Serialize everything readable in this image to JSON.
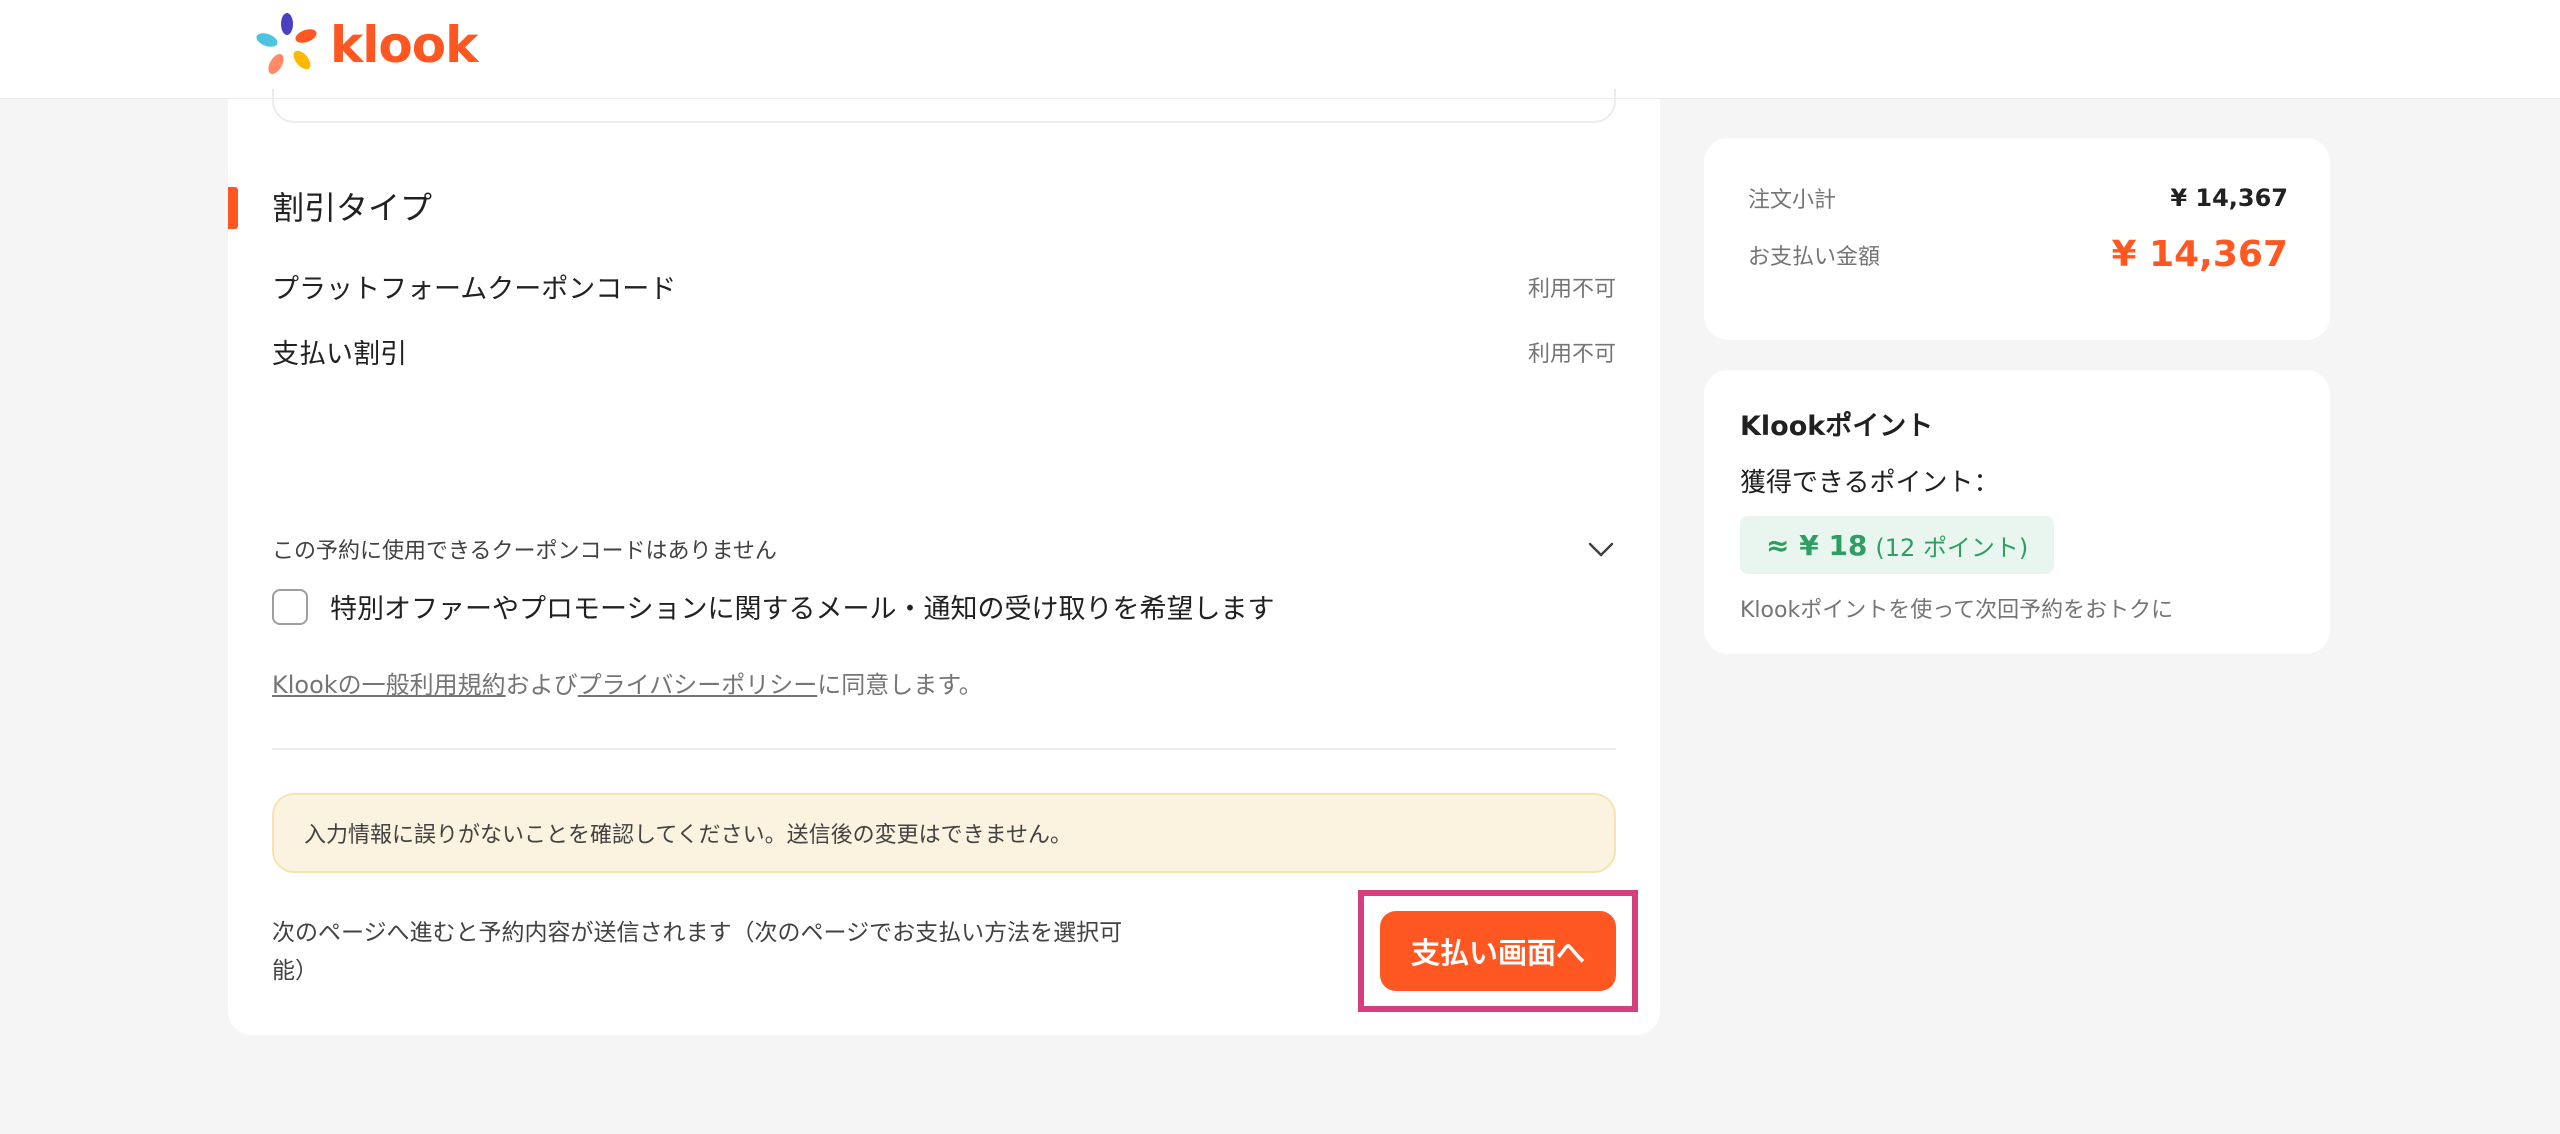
{
  "header": {
    "logo_text": "klook"
  },
  "discount": {
    "title": "割引タイプ",
    "rows": [
      {
        "label": "プラットフォームクーポンコード",
        "value": "利用不可"
      },
      {
        "label": "支払い割引",
        "value": "利用不可"
      }
    ],
    "coupon_text": "この予約に使用できるクーポンコードはありません"
  },
  "promo_checkbox_label": "特別オファーやプロモーションに関するメール・通知の受け取りを希望します",
  "terms": {
    "link1": "Klookの一般利用規約",
    "and": "および",
    "link2": "プライバシーポリシー",
    "suffix": "に同意します。"
  },
  "notice": "入力情報に誤りがないことを確認してください。送信後の変更はできません。",
  "submit_note": "次のページへ進むと予約内容が送信されます（次のページでお支払い方法を選択可能）",
  "submit_button": "支払い画面へ",
  "summary": {
    "subtotal_label": "注文小計",
    "subtotal_value": "¥ 14,367",
    "total_label": "お支払い金額",
    "total_value": "¥ 14,367"
  },
  "points": {
    "title": "Klookポイント",
    "subtitle": "獲得できるポイント：",
    "amount": "≈ ¥ 18",
    "count": "(12 ポイント)",
    "note": "Klookポイントを使って次回予約をおトクに"
  },
  "colors": {
    "accent": "#ff5722",
    "points_green": "#2e9e62",
    "highlight": "#d63f7d"
  }
}
